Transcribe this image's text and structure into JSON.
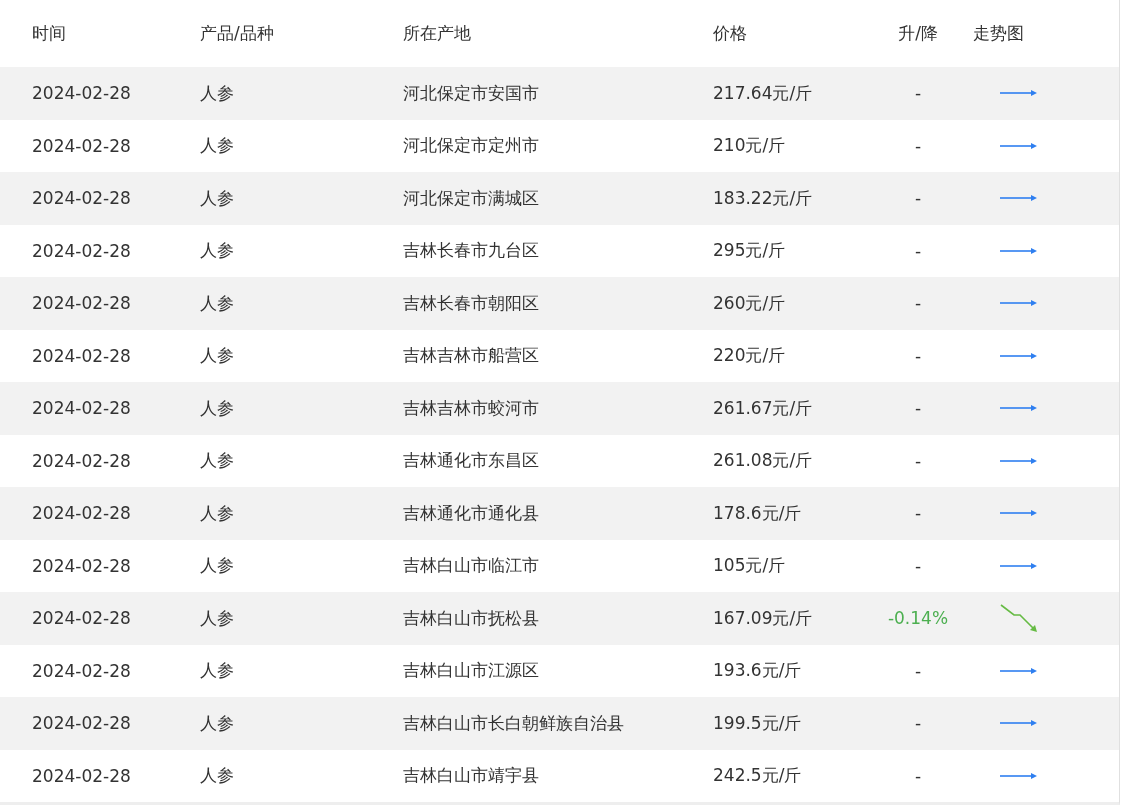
{
  "table": {
    "columns": [
      "时间",
      "产品/品种",
      "所在产地",
      "价格",
      "升/降",
      "走势图"
    ],
    "rows": [
      {
        "date": "2024-02-28",
        "product": "人参",
        "origin": "河北保定市安国市",
        "price": "217.64元/斤",
        "change": "-",
        "kind": "flat"
      },
      {
        "date": "2024-02-28",
        "product": "人参",
        "origin": "河北保定市定州市",
        "price": "210元/斤",
        "change": "-",
        "kind": "flat"
      },
      {
        "date": "2024-02-28",
        "product": "人参",
        "origin": "河北保定市满城区",
        "price": "183.22元/斤",
        "change": "-",
        "kind": "flat"
      },
      {
        "date": "2024-02-28",
        "product": "人参",
        "origin": "吉林长春市九台区",
        "price": "295元/斤",
        "change": "-",
        "kind": "flat"
      },
      {
        "date": "2024-02-28",
        "product": "人参",
        "origin": "吉林长春市朝阳区",
        "price": "260元/斤",
        "change": "-",
        "kind": "flat"
      },
      {
        "date": "2024-02-28",
        "product": "人参",
        "origin": "吉林吉林市船营区",
        "price": "220元/斤",
        "change": "-",
        "kind": "flat"
      },
      {
        "date": "2024-02-28",
        "product": "人参",
        "origin": "吉林吉林市蛟河市",
        "price": "261.67元/斤",
        "change": "-",
        "kind": "flat"
      },
      {
        "date": "2024-02-28",
        "product": "人参",
        "origin": "吉林通化市东昌区",
        "price": "261.08元/斤",
        "change": "-",
        "kind": "flat"
      },
      {
        "date": "2024-02-28",
        "product": "人参",
        "origin": "吉林通化市通化县",
        "price": "178.6元/斤",
        "change": "-",
        "kind": "flat"
      },
      {
        "date": "2024-02-28",
        "product": "人参",
        "origin": "吉林白山市临江市",
        "price": "105元/斤",
        "change": "-",
        "kind": "flat"
      },
      {
        "date": "2024-02-28",
        "product": "人参",
        "origin": "吉林白山市抚松县",
        "price": "167.09元/斤",
        "change": "-0.14%",
        "kind": "down"
      },
      {
        "date": "2024-02-28",
        "product": "人参",
        "origin": "吉林白山市江源区",
        "price": "193.6元/斤",
        "change": "-",
        "kind": "flat"
      },
      {
        "date": "2024-02-28",
        "product": "人参",
        "origin": "吉林白山市长白朝鲜族自治县",
        "price": "199.5元/斤",
        "change": "-",
        "kind": "flat"
      },
      {
        "date": "2024-02-28",
        "product": "人参",
        "origin": "吉林白山市靖宇县",
        "price": "242.5元/斤",
        "change": "-",
        "kind": "flat"
      }
    ]
  }
}
